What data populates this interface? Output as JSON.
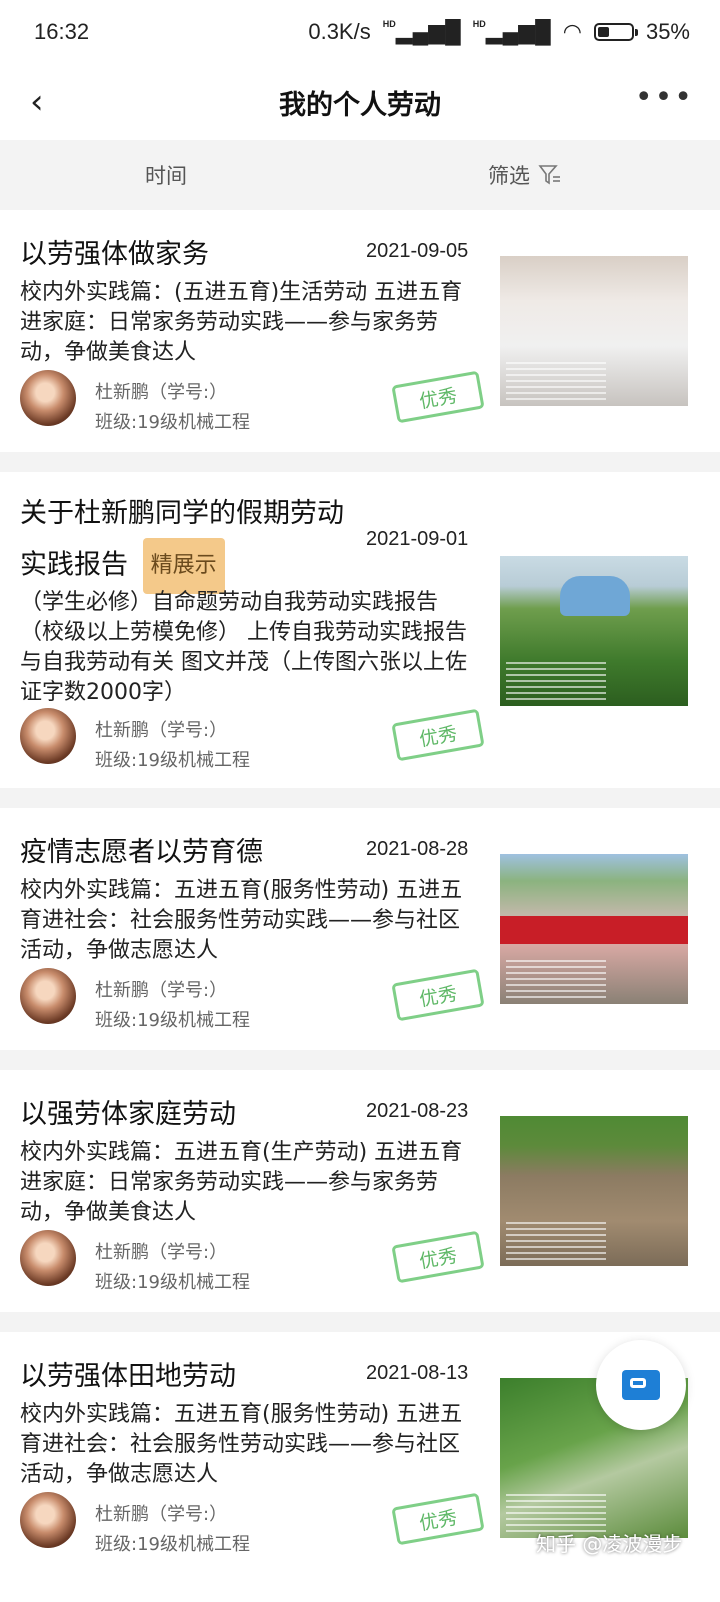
{
  "status": {
    "time": "16:32",
    "network": "0.3K/s",
    "hd1": "HD",
    "hd2": "HD",
    "battery": "35%",
    "battery_level": 0.35
  },
  "nav": {
    "back_icon": "‹",
    "title": "我的个人劳动",
    "more_icon": "•••"
  },
  "filters": {
    "time_label": "时间",
    "screen_label": "筛选"
  },
  "items": [
    {
      "title": "以劳强体做家务",
      "date": "2021-09-05",
      "desc": "校内外实践篇：(五进五育)生活劳动 五进五育进家庭：日常家务劳动实践——参与家务劳动，争做美食达人",
      "name": "杜新鹏（学号:）",
      "class": "班级:19级机械工程",
      "stamp": "优秀"
    },
    {
      "title": "关于杜新鹏同学的假期劳动实践报告",
      "badge": "精展示",
      "date": "2021-09-01",
      "desc": "（学生必修）自命题劳动自我劳动实践报告（校级以上劳模免修） 上传自我劳动实践报告与自我劳动有关 图文并茂（上传图六张以上佐证字数2000字）",
      "name": "杜新鹏（学号:）",
      "class": "班级:19级机械工程",
      "stamp": "优秀"
    },
    {
      "title": "疫情志愿者以劳育德",
      "date": "2021-08-28",
      "desc": "校内外实践篇：五进五育(服务性劳动) 五进五育进社会：社会服务性劳动实践——参与社区活动，争做志愿达人",
      "name": "杜新鹏（学号:）",
      "class": "班级:19级机械工程",
      "stamp": "优秀"
    },
    {
      "title": "以强劳体家庭劳动",
      "date": "2021-08-23",
      "desc": "校内外实践篇：五进五育(生产劳动) 五进五育进家庭：日常家务劳动实践——参与家务劳动，争做美食达人",
      "name": "杜新鹏（学号:）",
      "class": "班级:19级机械工程",
      "stamp": "优秀"
    },
    {
      "title": "以劳强体田地劳动",
      "date": "2021-08-13",
      "desc": "校内外实践篇：五进五育(服务性劳动) 五进五育进社会：社会服务性劳动实践——参与社区活动，争做志愿达人",
      "name": "杜新鹏（学号:）",
      "class": "班级:19级机械工程",
      "stamp": "优秀"
    }
  ],
  "watermark": "知乎 @凌波漫步"
}
